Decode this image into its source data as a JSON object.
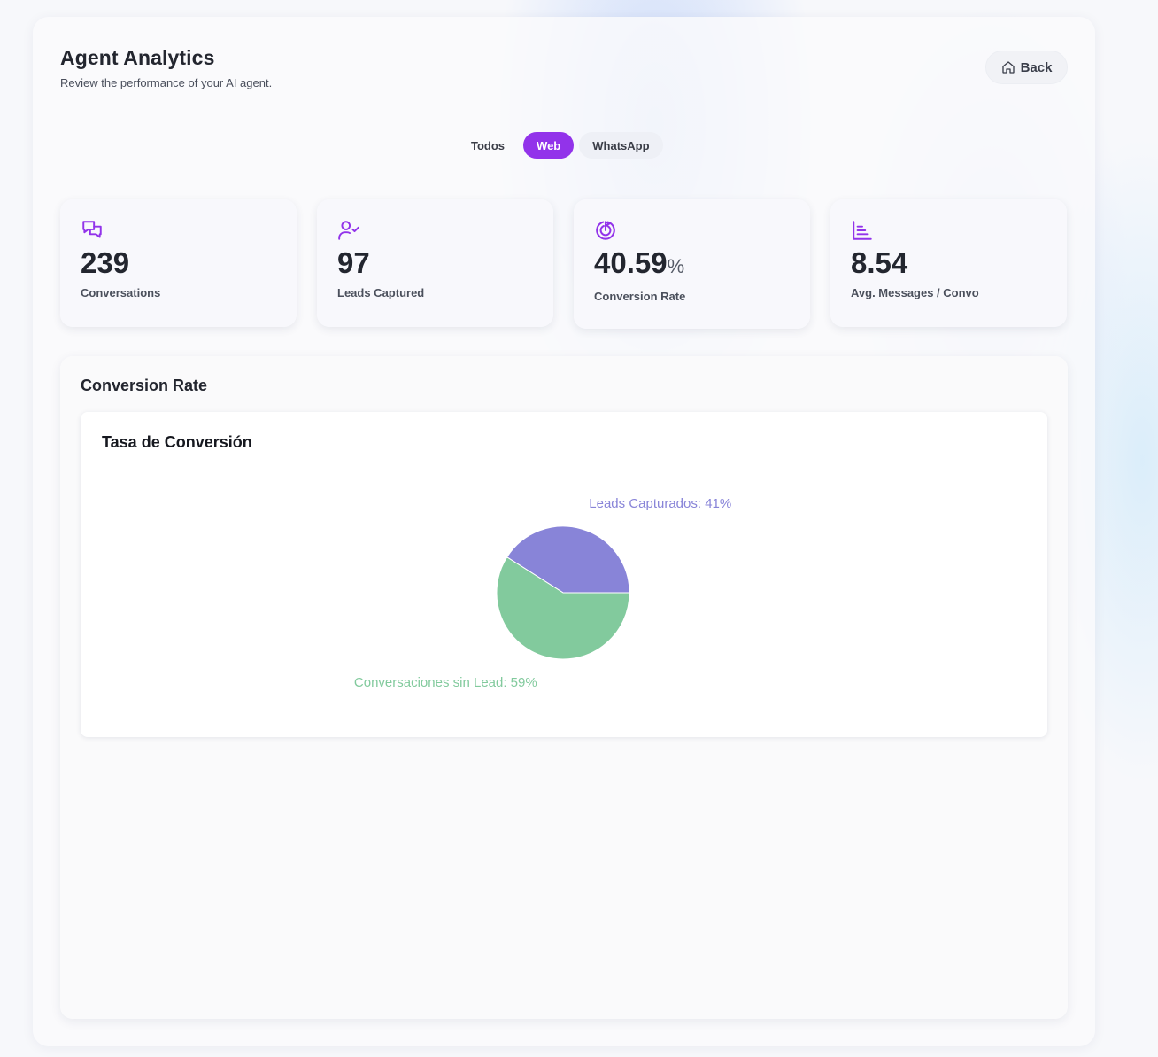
{
  "header": {
    "title": "Agent Analytics",
    "subtitle": "Review the performance of your AI agent.",
    "back_label": "Back",
    "back_icon": "home-icon"
  },
  "channel_tabs": [
    {
      "label": "Todos",
      "active": false
    },
    {
      "label": "Web",
      "active": true
    },
    {
      "label": "WhatsApp",
      "active": false
    }
  ],
  "accent_color": "#9233ea",
  "stats": [
    {
      "icon": "chat-bubbles-icon",
      "value": "239",
      "unit": "",
      "label": "Conversations"
    },
    {
      "icon": "user-check-icon",
      "value": "97",
      "unit": "",
      "label": "Leads Captured"
    },
    {
      "icon": "target-icon",
      "value": "40.59",
      "unit": "%",
      "label": "Conversion Rate"
    },
    {
      "icon": "bar-chart-icon",
      "value": "8.54",
      "unit": "",
      "label": "Avg. Messages / Convo"
    }
  ],
  "panel": {
    "title": "Conversion Rate"
  },
  "chart_data": {
    "type": "pie",
    "title": "Tasa de Conversión",
    "slices": [
      {
        "label": "Leads Capturados: 41%",
        "name": "Leads Capturados",
        "value": 41,
        "color": "#8884d8"
      },
      {
        "label": "Conversaciones sin Lead: 59%",
        "name": "Conversaciones sin Lead",
        "value": 59,
        "color": "#82ca9d"
      }
    ]
  }
}
